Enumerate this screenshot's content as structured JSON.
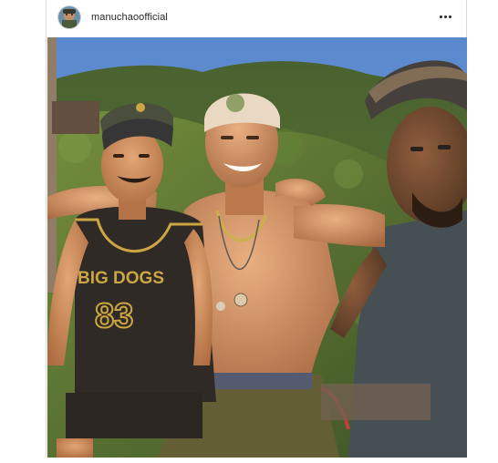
{
  "post": {
    "username": "manuchaoofficial",
    "avatar_alt": "profile-avatar",
    "more_icon": "more-options-icon"
  },
  "photo": {
    "shirt_text_line1": "BIG DOGS",
    "shirt_text_line2": "83",
    "colors": {
      "sky": "#5a8fd6",
      "hills": "#3d5a2a",
      "skin": "#c98a5c",
      "shirt": "#2a2a2a",
      "shirt_print": "#c9a640"
    }
  }
}
